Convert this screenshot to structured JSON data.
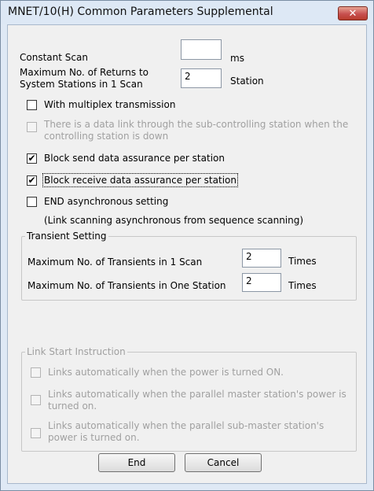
{
  "window": {
    "title": "MNET/10(H) Common Parameters Supplemental",
    "close_label": "✕"
  },
  "constant_scan": {
    "label": "Constant Scan",
    "value": "",
    "unit": "ms"
  },
  "max_returns": {
    "label_line1": "Maximum No. of Returns to",
    "label_line2": "System Stations in 1 Scan",
    "value": "2",
    "unit": "Station"
  },
  "checkboxes": {
    "multiplex": {
      "label": "With multiplex transmission",
      "checked": false
    },
    "sub_controlling": {
      "label_line1": "There is a data link through the sub-controlling station when the",
      "label_line2": "controlling station is down",
      "checked": false
    },
    "block_send": {
      "label": "Block send data assurance per station",
      "checked": true
    },
    "block_receive": {
      "label": "Block receive data assurance per station",
      "checked": true
    },
    "end_async": {
      "label": "END asynchronous setting",
      "checked": false
    },
    "end_async_note": "(Link scanning asynchronous from sequence scanning)"
  },
  "transient": {
    "group_label": "Transient Setting",
    "per_scan_label": "Maximum No. of Transients in 1 Scan",
    "per_scan_value": "2",
    "per_station_label": "Maximum No. of Transients in One Station",
    "per_station_value": "2",
    "unit": "Times"
  },
  "link_start": {
    "group_label": "Link Start Instruction",
    "option1": "Links automatically when the power is turned ON.",
    "option2_line1": "Links automatically when the parallel master station's power is",
    "option2_line2": "turned on.",
    "option3_line1": "Links automatically when the parallel sub-master station's",
    "option3_line2": "power is turned on."
  },
  "buttons": {
    "end": "End",
    "cancel": "Cancel"
  },
  "icons": {
    "check": "✔"
  }
}
